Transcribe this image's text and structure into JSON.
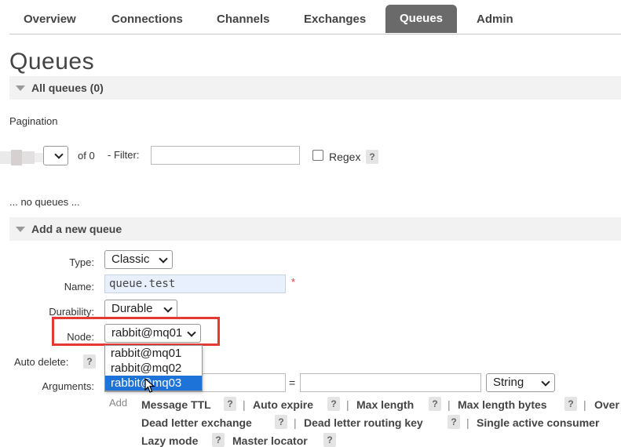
{
  "nav": {
    "tabs": [
      "Overview",
      "Connections",
      "Channels",
      "Exchanges",
      "Queues",
      "Admin"
    ],
    "active": "Queues"
  },
  "page": {
    "title": "Queues"
  },
  "all_queues": {
    "header": "All queues (0)",
    "pagination_label": "Pagination",
    "of_label": "of 0",
    "filter_label": "- Filter:",
    "filter_value": "",
    "regex_label": "Regex",
    "empty_text": "... no queues ..."
  },
  "add_queue": {
    "header": "Add a new queue",
    "type_label": "Type:",
    "type_value": "Classic",
    "name_label": "Name:",
    "name_value": "queue.test",
    "required_mark": "*",
    "durability_label": "Durability:",
    "durability_value": "Durable",
    "node_label": "Node:",
    "node_value": "rabbit@mq01",
    "node_options": [
      "rabbit@mq01",
      "rabbit@mq02",
      "rabbit@mq03"
    ],
    "node_highlighted": "rabbit@mq03",
    "auto_delete_label": "Auto delete:",
    "arguments_label": "Arguments:",
    "arg_equals": "=",
    "arg_type_value": "String",
    "add_label": "Add",
    "features_row1": [
      "Message TTL",
      "Auto expire",
      "Max length",
      "Max length bytes",
      "Over"
    ],
    "features_row2": [
      "Dead letter exchange",
      "Dead letter routing key",
      "Single active consumer"
    ],
    "features_row3": [
      "Lazy mode",
      "Master locator"
    ]
  },
  "help_glyph": "?",
  "separator": "|",
  "colors": {
    "active_tab": "#6a6a6a",
    "highlight_box": "#e53935",
    "selected_option": "#1e73d8",
    "section_bg": "#f2f2f2"
  }
}
